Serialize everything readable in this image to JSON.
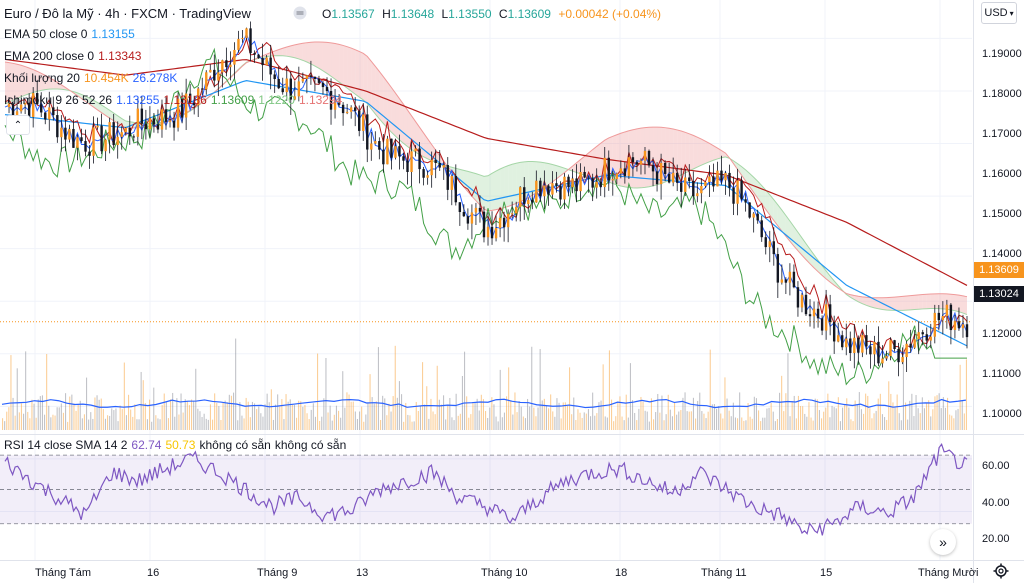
{
  "header": {
    "title": "Euro / Đô la Mỹ · 4h · FXCM · TradingView",
    "ohlc": [
      {
        "key": "O",
        "value": "1.13567"
      },
      {
        "key": "H",
        "value": "1.13648"
      },
      {
        "key": "L",
        "value": "1.13550"
      },
      {
        "key": "C",
        "value": "1.13609"
      }
    ],
    "change": "+0.00042 (+0.04%)",
    "currency": "USD"
  },
  "legends": {
    "ema50": {
      "label": "EMA 50 close 0",
      "value": "1.13155"
    },
    "ema200": {
      "label": "EMA 200 close 0",
      "value": "1.13343"
    },
    "volume": {
      "label": "Khối lượng 20",
      "v1": "10.454K",
      "v2": "26.278K"
    },
    "ichimoku": {
      "label": "Ichimoku 9 26 52 26",
      "v1": "1.13255",
      "v2": "1.13186",
      "v3": "1.13609",
      "v4": "1.1220",
      "v5": "1.13294"
    },
    "rsi": {
      "label": "RSI 14 close SMA 14 2",
      "v1": "62.74",
      "v2": "50.73",
      "v3": "không có sẵn",
      "v4": "không có sẵn"
    }
  },
  "price_axis": {
    "ticks": [
      "1.19000",
      "1.18000",
      "1.17000",
      "1.16000",
      "1.15000",
      "1.14000",
      "1.12000",
      "1.11000",
      "1.10000"
    ],
    "last_price": "1.13609",
    "cursor_price": "1.13024"
  },
  "rsi_axis": {
    "ticks": [
      "60.00",
      "40.00",
      "20.00"
    ]
  },
  "time_axis": {
    "labels": [
      "Tháng Tám",
      "16",
      "Tháng 9",
      "13",
      "Tháng 10",
      "18",
      "Tháng 11",
      "15",
      "Tháng Mười"
    ]
  },
  "colors": {
    "up": "#26a69a",
    "down": "#ef5350",
    "ema50": "#2196f3",
    "ema200": "#b71c1c",
    "tenkan": "#2962ff",
    "kijun": "#b71c1c",
    "chikou": "#43a047",
    "spanA": "#a5d6a7",
    "spanB": "#ef9a9a",
    "rsi": "#7e57c2",
    "orange": "#f7941d"
  },
  "chart_data": {
    "type": "line",
    "symbol": "EURUSD 4h",
    "price_ylim": [
      1.1155,
      1.1935
    ],
    "x": [
      "Tháng Tám",
      "16",
      "Tháng 9",
      "13",
      "Tháng 10",
      "18",
      "Tháng 11",
      "15",
      "Tháng Mười"
    ],
    "series": [
      {
        "name": "EMA 50 close 0",
        "values": [
          1.1755,
          1.173,
          1.182,
          1.178,
          1.159,
          1.164,
          1.162,
          1.143,
          1.1315
        ]
      },
      {
        "name": "EMA 200 close 0",
        "values": [
          1.186,
          1.183,
          1.186,
          1.18,
          1.171,
          1.167,
          1.164,
          1.155,
          1.143
        ]
      },
      {
        "name": "close",
        "values": [
          1.177,
          1.17,
          1.188,
          1.173,
          1.156,
          1.166,
          1.161,
          1.13,
          1.1361
        ]
      }
    ],
    "rsi": {
      "ylim": [
        10,
        80
      ],
      "bands": [
        30,
        70
      ],
      "mid": 50,
      "values": [
        66,
        55,
        45,
        35,
        60,
        55,
        62,
        68,
        60,
        50,
        40,
        45,
        35,
        38,
        50,
        55,
        60,
        45,
        40,
        32,
        45,
        55,
        60,
        62,
        55,
        48,
        60,
        50,
        40,
        35,
        25,
        30,
        40,
        36,
        45,
        72,
        63
      ]
    },
    "volume_ylim": [
      0,
      100
    ]
  }
}
